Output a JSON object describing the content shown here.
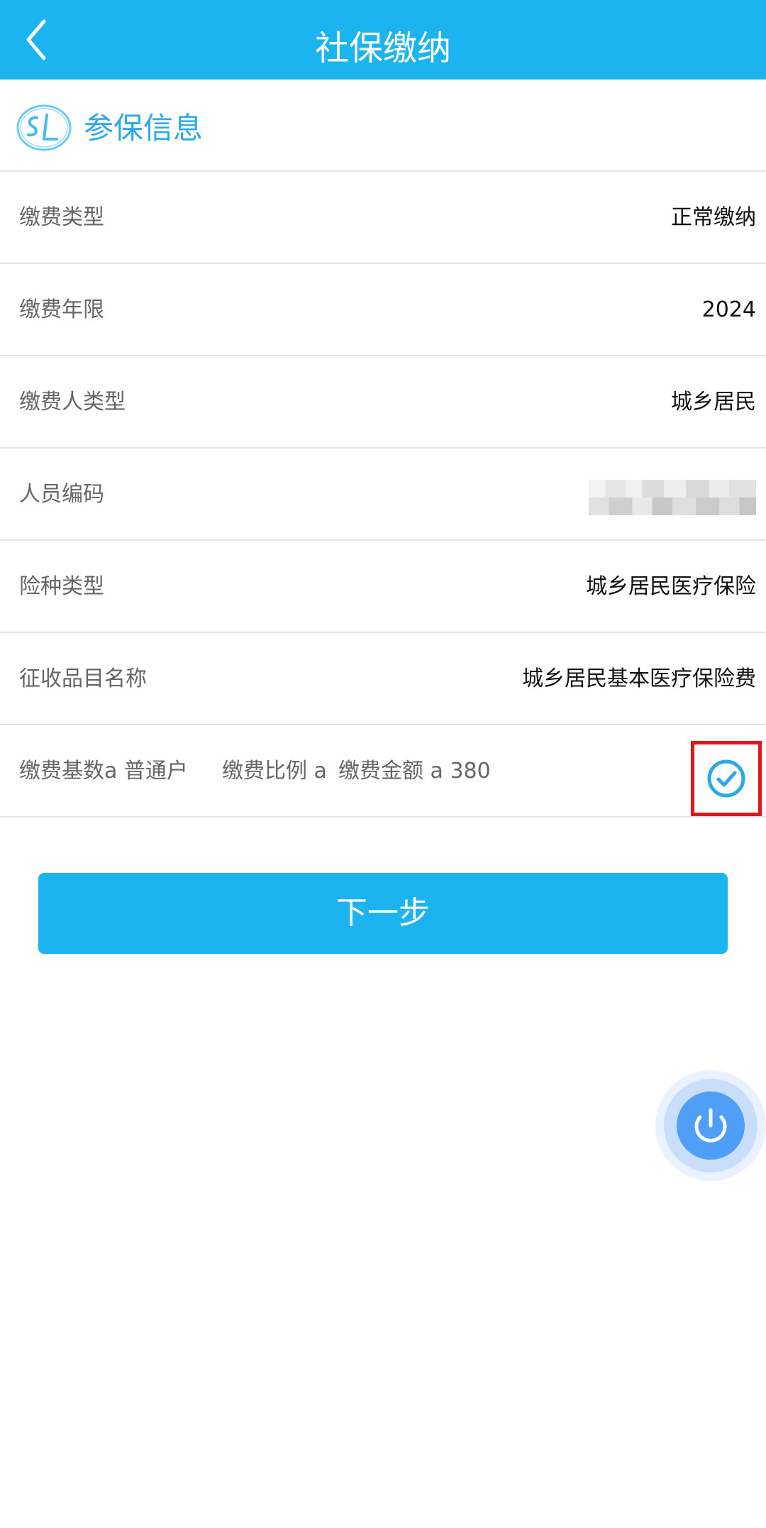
{
  "header": {
    "title": "社保缴纳",
    "back_icon": "chevron-left-icon"
  },
  "section": {
    "title": "参保信息",
    "logo_icon": "social-insurance-logo-icon"
  },
  "rows": [
    {
      "label": "缴费类型",
      "value": "正常缴纳"
    },
    {
      "label": "缴费年限",
      "value": "2024"
    },
    {
      "label": "缴费人类型",
      "value": "城乡居民"
    },
    {
      "label": "人员编码",
      "value": ""
    },
    {
      "label": "险种类型",
      "value": "城乡居民医疗保险"
    },
    {
      "label": "征收品目名称",
      "value": "城乡居民基本医疗保险费"
    }
  ],
  "fee": {
    "base": "缴费基数a 普通户",
    "ratio": "缴费比例 a",
    "amount": "缴费金额 a 380",
    "check_icon": "check-circle-icon"
  },
  "next_button": {
    "label": "下一步"
  },
  "fab": {
    "icon": "power-icon"
  },
  "colors": {
    "primary": "#1cb4f0",
    "section_title": "#2ba9e8",
    "highlight_border": "#e4141b",
    "fab": "#4e9ff5"
  }
}
